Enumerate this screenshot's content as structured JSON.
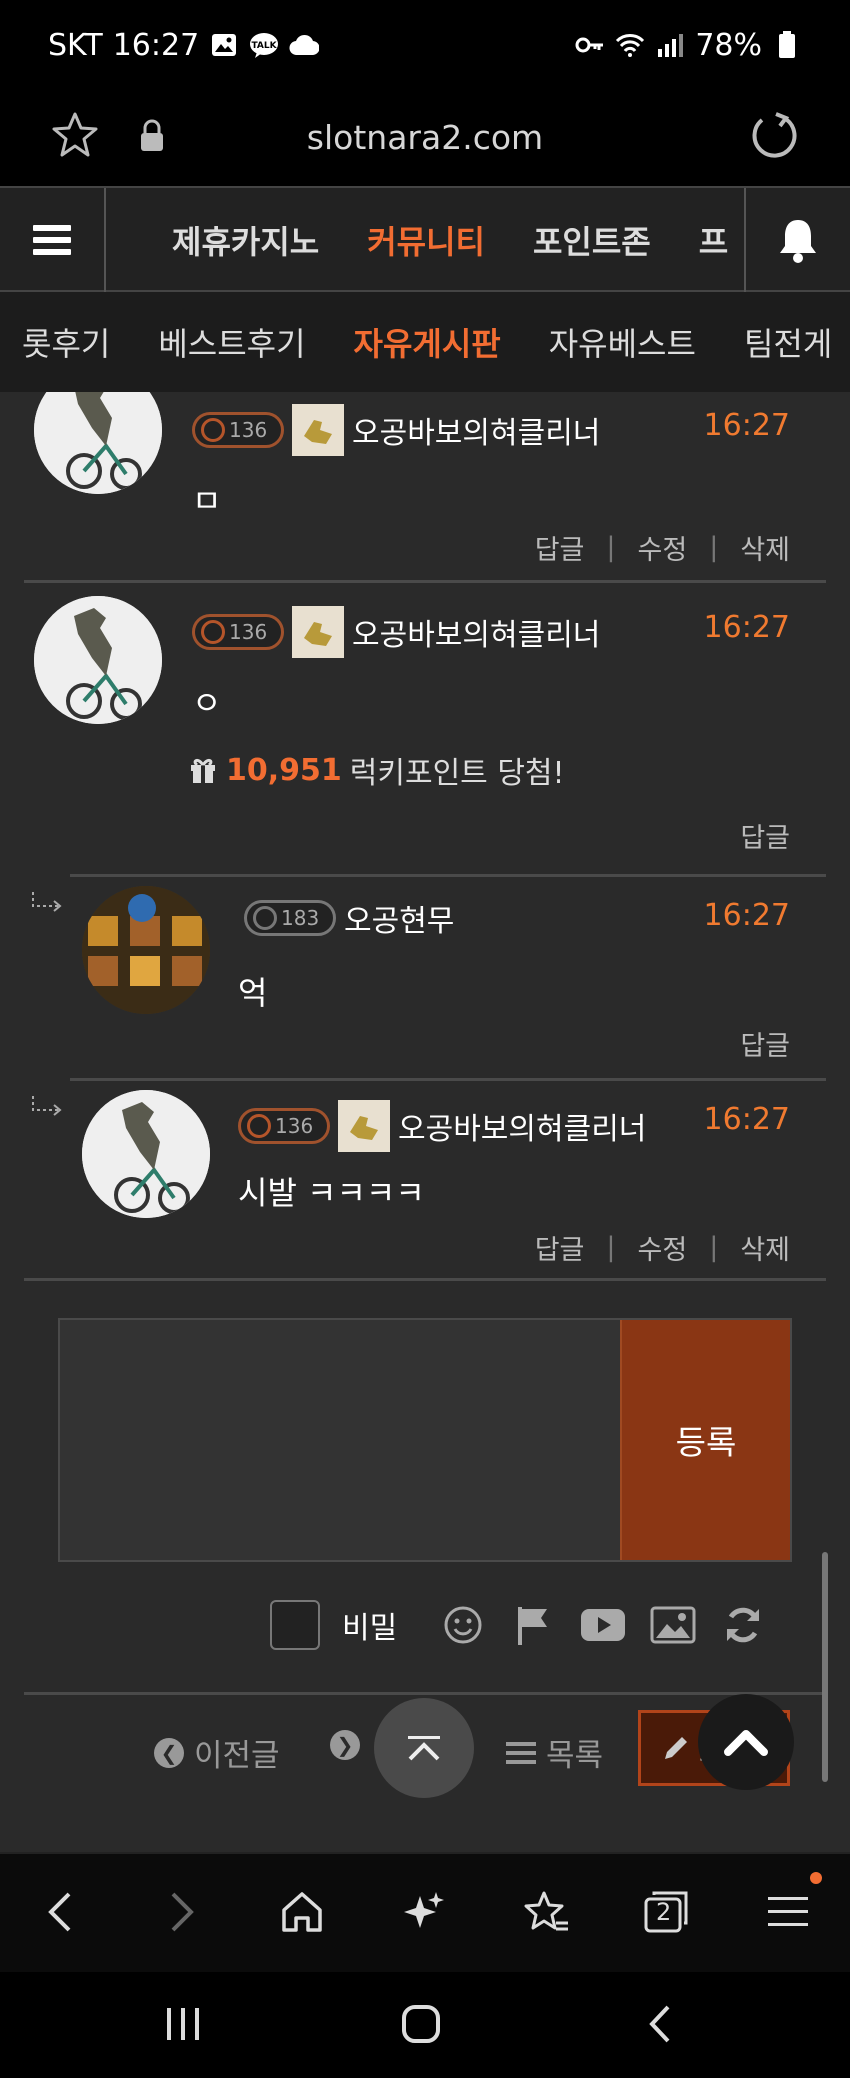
{
  "status_bar": {
    "carrier": "SKT",
    "time": "16:27",
    "battery": "78%",
    "icons": [
      "gallery-icon",
      "talk-icon",
      "cloud-icon",
      "key-icon",
      "wifi-icon",
      "signal-icon",
      "battery-icon"
    ]
  },
  "browser": {
    "url": "slotnara2.com"
  },
  "main_nav": {
    "items": [
      {
        "label": "제휴카지노"
      },
      {
        "label": "커뮤니티"
      },
      {
        "label": "포인트존"
      },
      {
        "label": "프"
      }
    ],
    "active": "커뮤니티"
  },
  "sub_nav": {
    "items": [
      {
        "label": "롯후기"
      },
      {
        "label": "베스트후기"
      },
      {
        "label": "자유게시판"
      },
      {
        "label": "자유베스트"
      },
      {
        "label": "팀전게"
      }
    ],
    "active": "자유게시판"
  },
  "comments": [
    {
      "level": "136",
      "username": "오공바보의혀클리너",
      "time": "16:27",
      "text": "ㅁ",
      "actions": [
        "답글",
        "수정",
        "삭제"
      ]
    },
    {
      "level": "136",
      "username": "오공바보의혀클리너",
      "time": "16:27",
      "text": "ㅇ",
      "lucky_amount": "10,951",
      "lucky_text": "럭키포인트 당첨!",
      "actions": [
        "답글"
      ]
    },
    {
      "level": "183",
      "username": "오공현무",
      "time": "16:27",
      "text": "억",
      "actions": [
        "답글"
      ]
    },
    {
      "level": "136",
      "username": "오공바보의혀클리너",
      "time": "16:27",
      "text": "시발 ㅋㅋㅋㅋ",
      "actions": [
        "답글",
        "수정",
        "삭제"
      ]
    }
  ],
  "compose": {
    "submit_label": "등록",
    "secret_label": "비밀"
  },
  "pager": {
    "prev_label": "이전글",
    "list_label": "목록",
    "write_label": "쓰기"
  },
  "colors": {
    "accent": "#f26d32",
    "time": "#f07a30",
    "submit_bg": "#8a3614",
    "background": "#2a2a2a"
  },
  "browser_nav": {
    "tabs_count": "2"
  }
}
